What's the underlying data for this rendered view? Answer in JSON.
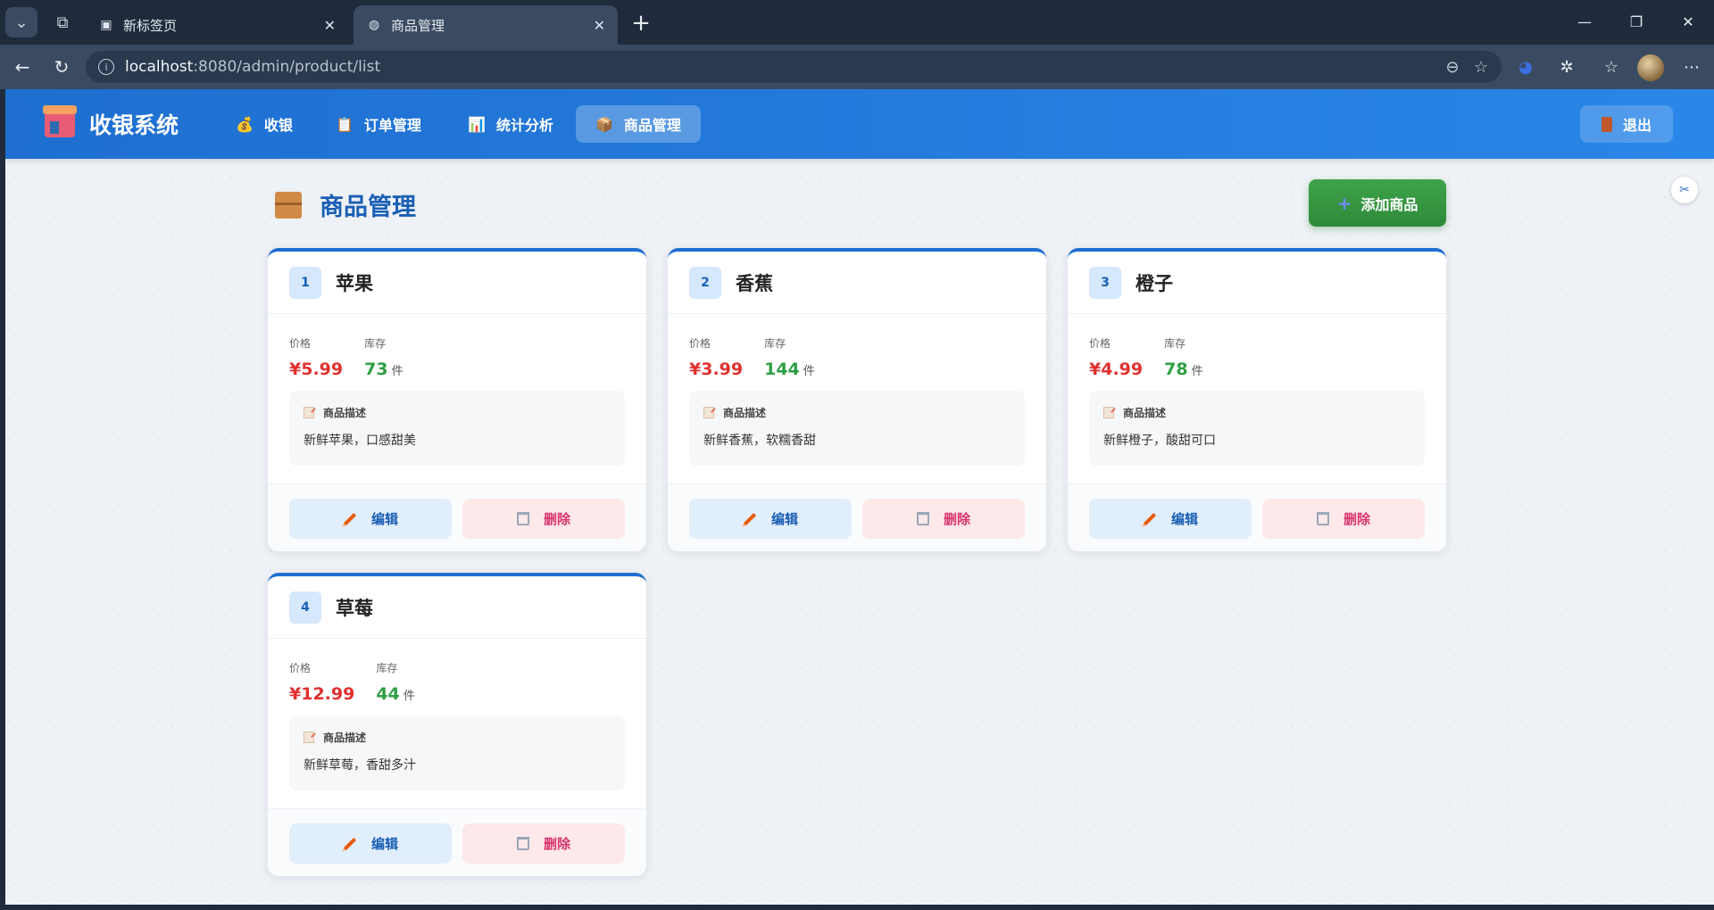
{
  "browser": {
    "tabs": [
      {
        "label": "新标签页",
        "icon": "newtab-page-icon",
        "active": false
      },
      {
        "label": "商品管理",
        "icon": "globe-icon",
        "active": true
      }
    ],
    "url_host": "localhost",
    "url_path": ":8080/admin/product/list"
  },
  "app": {
    "brand": "收银系统",
    "nav": [
      {
        "label": "收银",
        "icon": "money-bag-icon",
        "glyph": "💰",
        "active": false
      },
      {
        "label": "订单管理",
        "icon": "clipboard-icon",
        "glyph": "📋",
        "active": false
      },
      {
        "label": "统计分析",
        "icon": "bar-chart-icon",
        "glyph": "📊",
        "active": false
      },
      {
        "label": "商品管理",
        "icon": "package-icon",
        "glyph": "📦",
        "active": true
      }
    ],
    "logout": "退出"
  },
  "page": {
    "title": "商品管理",
    "add_button": "添加商品"
  },
  "labels": {
    "price": "价格",
    "stock": "库存",
    "unit": "件",
    "desc_title": "商品描述",
    "edit": "编辑",
    "delete": "删除"
  },
  "products": [
    {
      "id": "1",
      "name": "苹果",
      "price": "¥5.99",
      "stock": "73",
      "desc": "新鲜苹果，口感甜美"
    },
    {
      "id": "2",
      "name": "香蕉",
      "price": "¥3.99",
      "stock": "144",
      "desc": "新鲜香蕉，软糯香甜"
    },
    {
      "id": "3",
      "name": "橙子",
      "price": "¥4.99",
      "stock": "78",
      "desc": "新鲜橙子，酸甜可口"
    },
    {
      "id": "4",
      "name": "草莓",
      "price": "¥12.99",
      "stock": "44",
      "desc": "新鲜草莓，香甜多汁"
    }
  ]
}
